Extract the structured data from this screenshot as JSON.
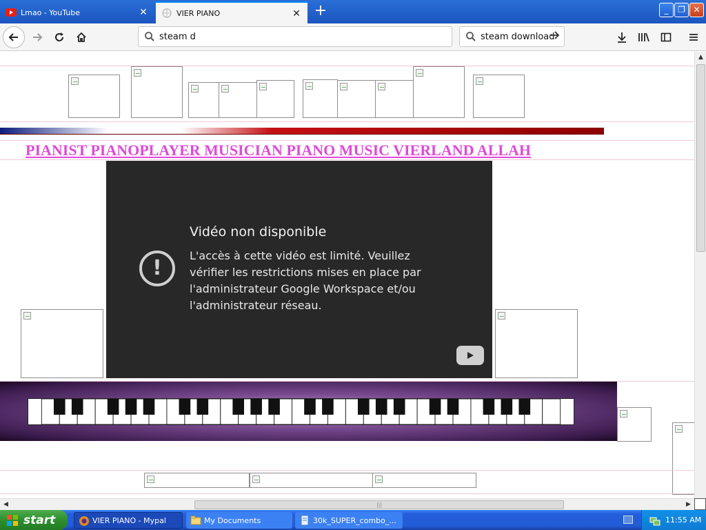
{
  "tabs": [
    {
      "label": "Lmao - YouTube",
      "icon": "youtube-icon"
    },
    {
      "label": "VIER PIANO",
      "icon": "globe-icon"
    }
  ],
  "nav": {
    "url_text": "steam d",
    "search_text": "steam download"
  },
  "page": {
    "heading": "PIANIST PIANOPLAYER MUSICIAN PIANO MUSIC VIERLAND ALLAH"
  },
  "video": {
    "title": "Vidéo non disponible",
    "message": "L'accès à cette vidéo est limité. Veuillez vérifier les restrictions mises en place par l'administrateur Google Workspace et/ou l'administrateur réseau."
  },
  "taskbar": {
    "start_label": "start",
    "tasks": [
      {
        "label": "VIER PIANO - Mypal"
      },
      {
        "label": "My Documents"
      },
      {
        "label": "30k_SUPER_combo_..."
      }
    ],
    "clock": "11:55 AM"
  },
  "colors": {
    "heading": "#e04ad8",
    "video_bg": "#282828",
    "taskbar": "#245edb",
    "start": "#2d8f2d"
  }
}
